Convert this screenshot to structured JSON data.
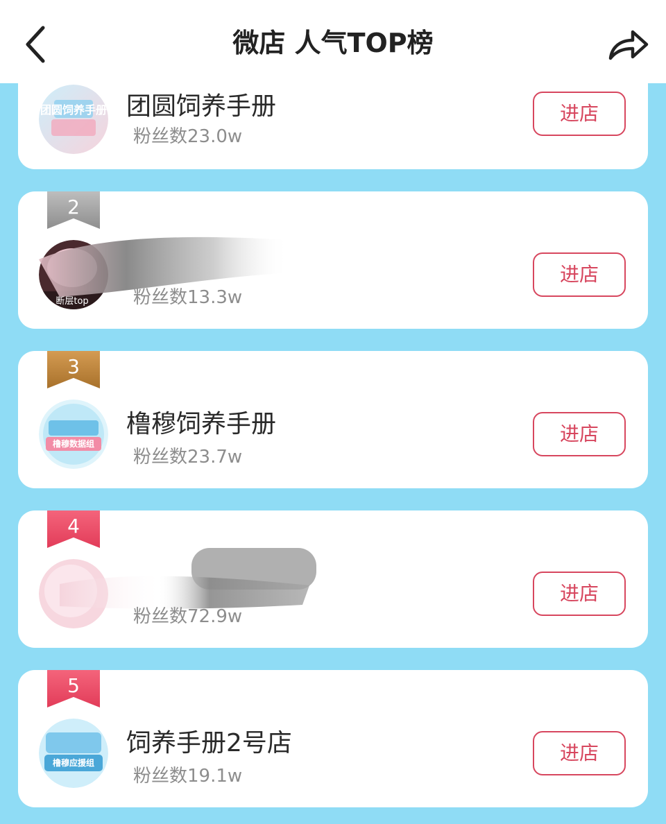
{
  "header": {
    "title": "微店 人气TOP榜",
    "back_icon": "chevron-left-icon",
    "share_icon": "share-arrow-icon"
  },
  "colors": {
    "page_background": "#8fdcf5",
    "card_background": "#ffffff",
    "button_accent": "#d7465e",
    "rank_silver": "#9e9e9e",
    "rank_bronze": "#b9813a",
    "rank_red": "#e8475f"
  },
  "shops": [
    {
      "rank": "",
      "name": "团圆饲养手册",
      "fans": "粉丝数23.0w",
      "enter_label": "进店",
      "avatar_label": "团圆饲养手册"
    },
    {
      "rank": "2",
      "name": "",
      "fans": "粉丝数13.3w",
      "enter_label": "进店",
      "avatar_label": "断层top"
    },
    {
      "rank": "3",
      "name": "橹穆饲养手册",
      "fans": "粉丝数23.7w",
      "enter_label": "进店",
      "avatar_label": "橹穆数据组"
    },
    {
      "rank": "4",
      "name": "",
      "fans": "粉丝数72.9w",
      "enter_label": "进店",
      "avatar_label": ""
    },
    {
      "rank": "5",
      "name": "饲养手册2号店",
      "fans": "粉丝数19.1w",
      "enter_label": "进店",
      "avatar_label": "橹穆应援组"
    }
  ]
}
